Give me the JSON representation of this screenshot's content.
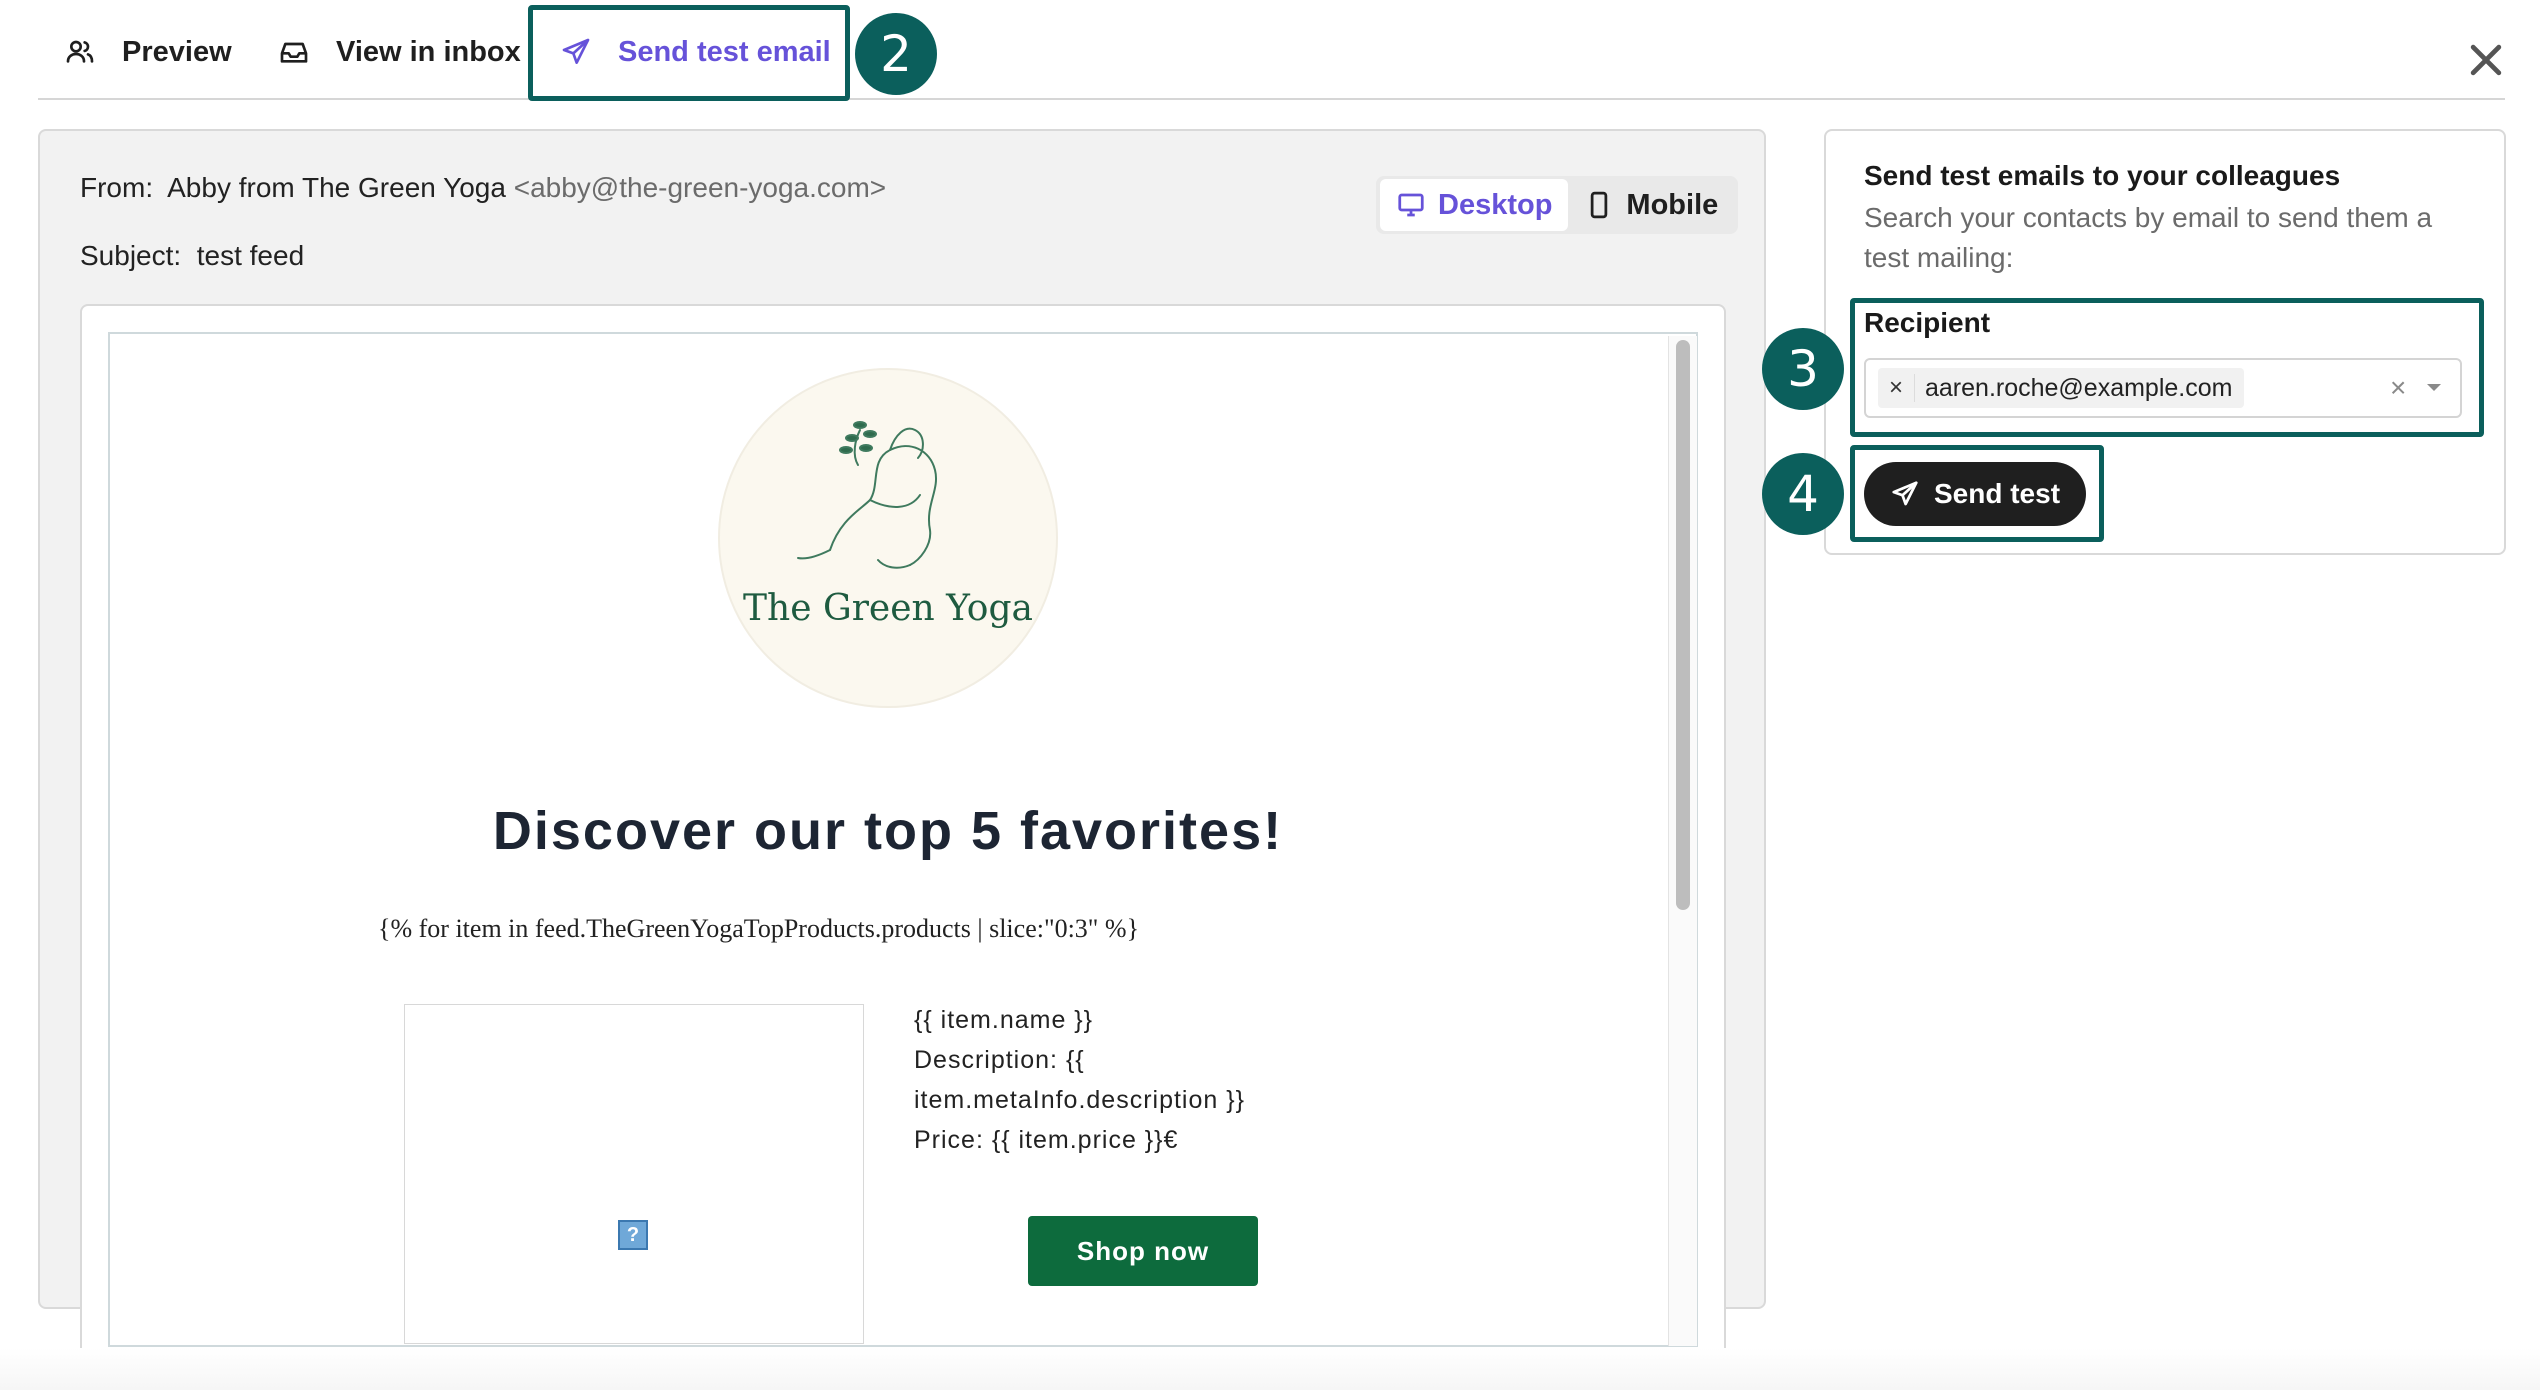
{
  "tabs": [
    {
      "label": "Preview",
      "icon": "users-icon"
    },
    {
      "label": "View in inbox",
      "icon": "inbox-icon"
    },
    {
      "label": "Send test email",
      "icon": "send-icon",
      "active": true
    }
  ],
  "annotations": {
    "step2": "2",
    "step3": "3",
    "step4": "4",
    "accent_color": "#0b5f5c"
  },
  "preview": {
    "from_label": "From:",
    "from_name": "Abby from The Green Yoga",
    "from_email": "<abby@the-green-yoga.com>",
    "subject_label": "Subject:",
    "subject_value": "test feed",
    "device_desktop": "Desktop",
    "device_mobile": "Mobile"
  },
  "email": {
    "brand": "The Green Yoga",
    "headline": "Discover our top 5 favorites!",
    "loop_tag": "{% for item in feed.TheGreenYogaTopProducts.products | slice:\"0:3\" %}",
    "item_name": "{{ item.name }}",
    "item_desc_1": "Description: {{",
    "item_desc_2": "item.metaInfo.description }}",
    "item_price": "Price: {{ item.price }}€",
    "broken_image": "?",
    "shop_button": "Shop now"
  },
  "side": {
    "title": "Send test emails to your colleagues",
    "description": "Search your contacts by email to send them a test mailing:",
    "recipient_label": "Recipient",
    "recipient_value": "aaren.roche@example.com",
    "chip_remove": "×",
    "clear": "×",
    "send_button": "Send test"
  }
}
